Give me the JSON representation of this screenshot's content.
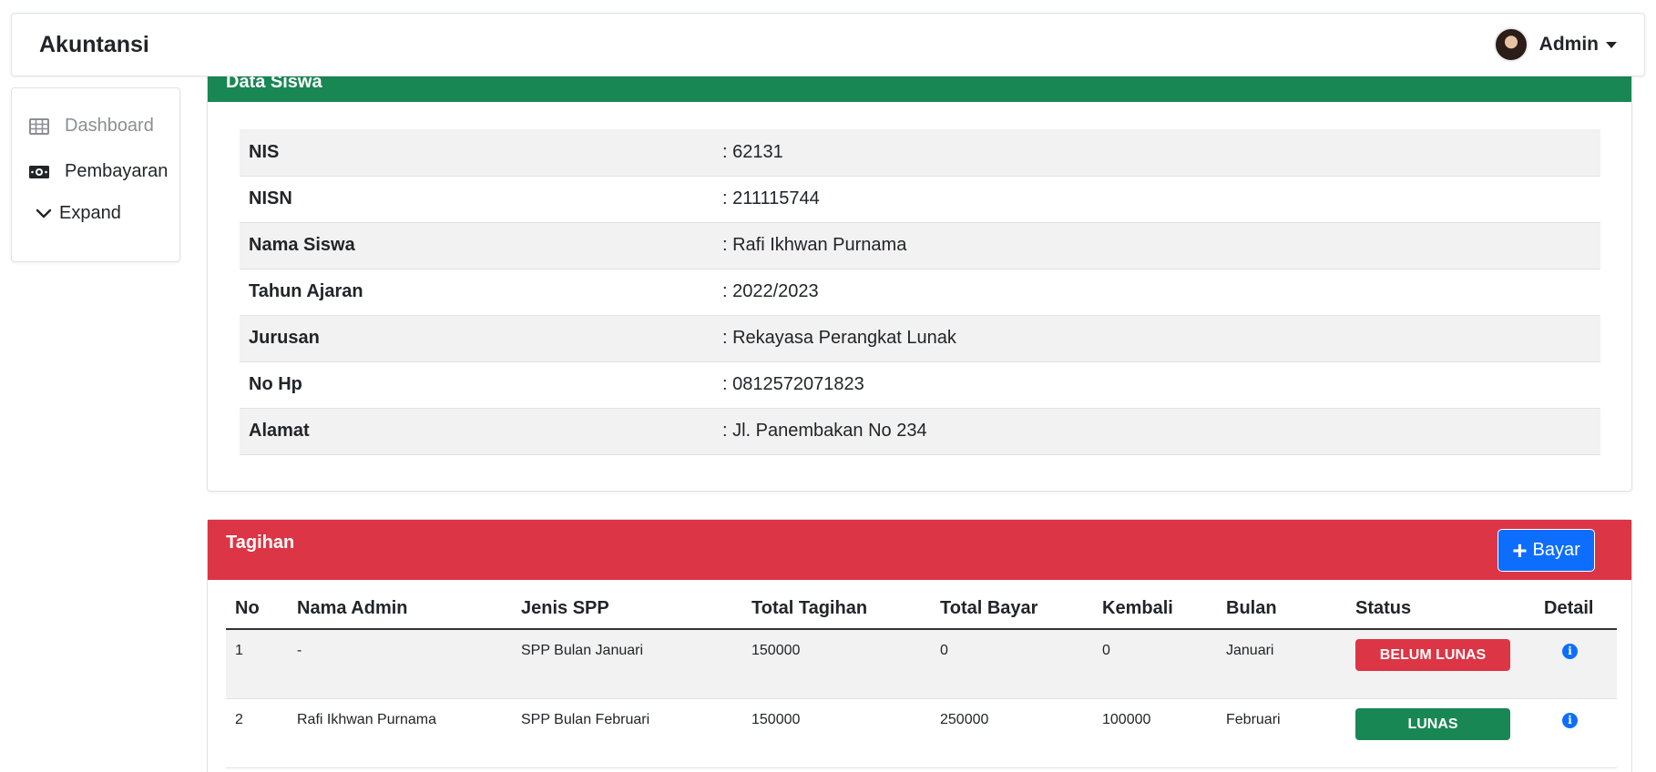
{
  "navbar": {
    "brand": "Akuntansi",
    "user_name": "Admin"
  },
  "sidebar": {
    "items": [
      {
        "label": "Dashboard",
        "icon": "table-icon"
      },
      {
        "label": "Pembayaran",
        "icon": "money-icon"
      },
      {
        "label": "Expand",
        "icon": "chevron-down-icon"
      }
    ]
  },
  "data_siswa": {
    "title": "Data Siswa",
    "rows": [
      {
        "label": "NIS",
        "value": ": 62131"
      },
      {
        "label": "NISN",
        "value": ": 211115744"
      },
      {
        "label": "Nama Siswa",
        "value": ": Rafi Ikhwan Purnama"
      },
      {
        "label": "Tahun Ajaran",
        "value": ": 2022/2023"
      },
      {
        "label": "Jurusan",
        "value": ": Rekayasa Perangkat Lunak"
      },
      {
        "label": "No Hp",
        "value": ": 0812572071823"
      },
      {
        "label": "Alamat",
        "value": ": Jl. Panembakan No 234"
      }
    ]
  },
  "tagihan": {
    "title": "Tagihan",
    "bayar_label": "Bayar",
    "columns": [
      "No",
      "Nama Admin",
      "Jenis SPP",
      "Total Tagihan",
      "Total Bayar",
      "Kembali",
      "Bulan",
      "Status",
      "Detail"
    ],
    "rows": [
      {
        "no": "1",
        "admin": "-",
        "jenis": "SPP Bulan Januari",
        "total_tagihan": "150000",
        "total_bayar": "0",
        "kembali": "0",
        "bulan": "Januari",
        "status": "BELUM LUNAS"
      },
      {
        "no": "2",
        "admin": "Rafi Ikhwan Purnama",
        "jenis": "SPP Bulan Februari",
        "total_tagihan": "150000",
        "total_bayar": "250000",
        "kembali": "100000",
        "bulan": "Februari",
        "status": "LUNAS"
      }
    ]
  },
  "colors": {
    "success": "#198754",
    "danger": "#dc3545",
    "primary": "#0d6efd"
  }
}
